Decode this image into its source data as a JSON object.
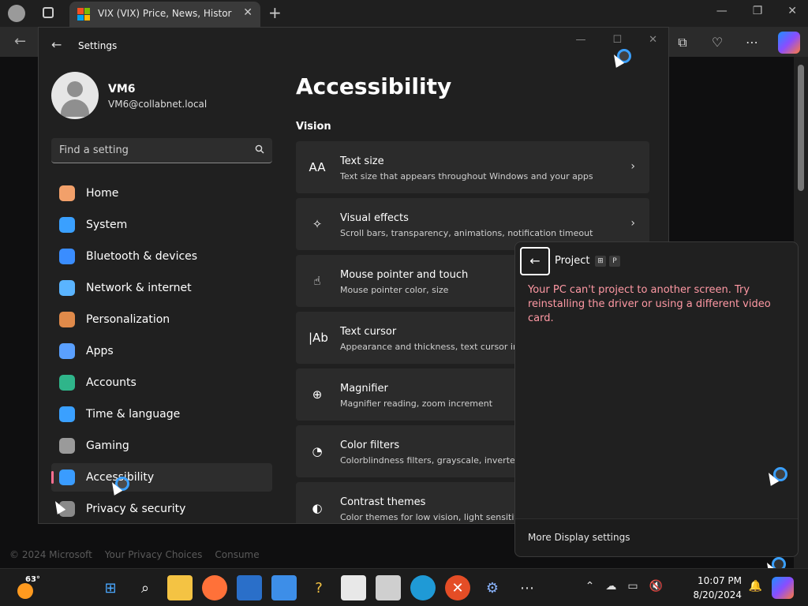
{
  "browser": {
    "tab_title": "VIX (VIX) Price, News, History, Pr",
    "footer": [
      "© 2024 Microsoft",
      "Your Privacy Choices",
      "Consume"
    ]
  },
  "settings": {
    "window_title": "Settings",
    "profile": {
      "name": "VM6",
      "email": "VM6@collabnet.local"
    },
    "search": {
      "placeholder": "Find a setting"
    },
    "nav": [
      {
        "label": "Home",
        "icon": "home-icon",
        "color": "#f2a06a"
      },
      {
        "label": "System",
        "icon": "system-icon",
        "color": "#3aa0ff"
      },
      {
        "label": "Bluetooth & devices",
        "icon": "bluetooth-icon",
        "color": "#3a8dff"
      },
      {
        "label": "Network & internet",
        "icon": "wifi-icon",
        "color": "#5ab4ff"
      },
      {
        "label": "Personalization",
        "icon": "brush-icon",
        "color": "#e08a4a"
      },
      {
        "label": "Apps",
        "icon": "apps-icon",
        "color": "#5aa0ff"
      },
      {
        "label": "Accounts",
        "icon": "accounts-icon",
        "color": "#2fb58a"
      },
      {
        "label": "Time & language",
        "icon": "clock-globe-icon",
        "color": "#3aa0ff"
      },
      {
        "label": "Gaming",
        "icon": "gamepad-icon",
        "color": "#9a9a9a"
      },
      {
        "label": "Accessibility",
        "icon": "accessibility-icon",
        "color": "#3a9cff",
        "active": true
      },
      {
        "label": "Privacy & security",
        "icon": "shield-icon",
        "color": "#8a8a8a"
      }
    ],
    "page_title": "Accessibility",
    "section_title": "Vision",
    "cards": [
      {
        "title": "Text size",
        "sub": "Text size that appears throughout Windows and your apps",
        "icon": "text-size-icon",
        "glyph": "AA"
      },
      {
        "title": "Visual effects",
        "sub": "Scroll bars, transparency, animations, notification timeout",
        "icon": "sparkle-icon",
        "glyph": "✧"
      },
      {
        "title": "Mouse pointer and touch",
        "sub": "Mouse pointer color, size",
        "icon": "pointer-touch-icon",
        "glyph": "☝"
      },
      {
        "title": "Text cursor",
        "sub": "Appearance and thickness, text cursor indicator",
        "icon": "text-cursor-icon",
        "glyph": "|Ab"
      },
      {
        "title": "Magnifier",
        "sub": "Magnifier reading, zoom increment",
        "icon": "magnifier-icon",
        "glyph": "⊕"
      },
      {
        "title": "Color filters",
        "sub": "Colorblindness filters, grayscale, inverted",
        "icon": "palette-icon",
        "glyph": "◔"
      },
      {
        "title": "Contrast themes",
        "sub": "Color themes for low vision, light sensitivity",
        "icon": "contrast-icon",
        "glyph": "◐"
      }
    ]
  },
  "project": {
    "title": "Project",
    "keys": [
      "⊞",
      "P"
    ],
    "message": "Your PC can't project to another screen. Try reinstalling the driver or using a different video card.",
    "footer_link": "More Display settings"
  },
  "taskbar": {
    "temperature": "63°",
    "time": "10:07 PM",
    "date": "8/20/2024"
  }
}
